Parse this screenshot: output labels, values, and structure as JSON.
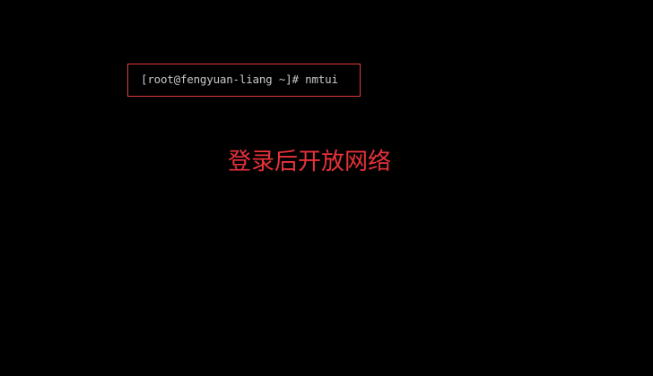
{
  "terminal": {
    "prompt": "[root@fengyuan-liang ~]#",
    "command": "nmtui"
  },
  "annotation": {
    "text": "登录后开放网络"
  },
  "colors": {
    "background": "#000000",
    "terminal_text": "#c8c8c8",
    "highlight_border": "#e03a3a",
    "annotation_text": "#e8323a"
  }
}
